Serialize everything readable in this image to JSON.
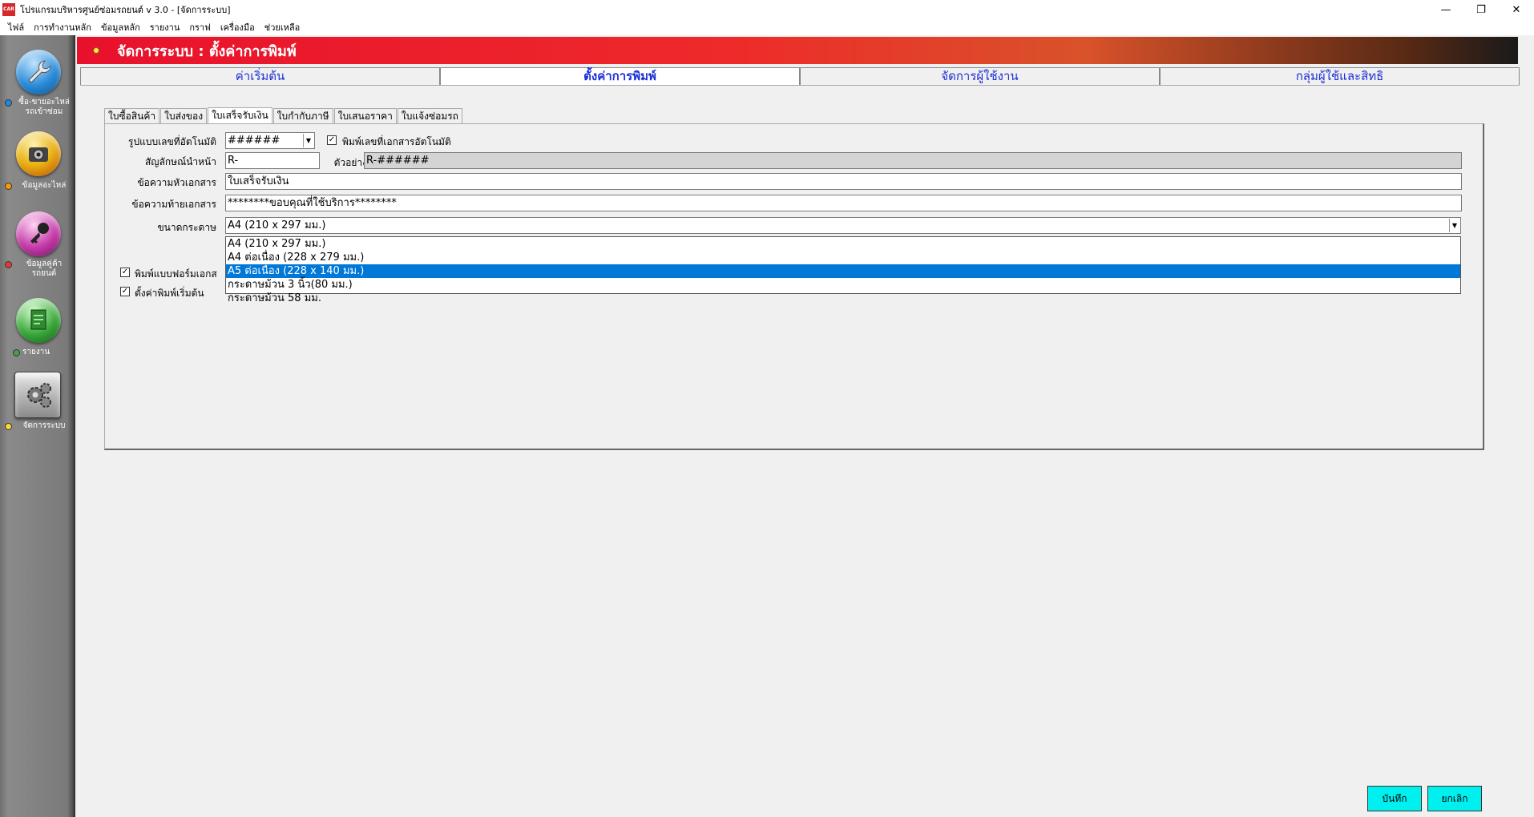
{
  "window": {
    "app_icon_text": "CAR",
    "title": "โปรแกรมบริหารศูนย์ซ่อมรถยนต์ v 3.0 - [จัดการระบบ]",
    "controls": {
      "minimize": "—",
      "restore": "❐",
      "close": "✕"
    }
  },
  "menubar": {
    "items": [
      {
        "label": "ไฟล์"
      },
      {
        "label": "การทำงานหลัก"
      },
      {
        "label": "ข้อมูลหลัก"
      },
      {
        "label": "รายงาน"
      },
      {
        "label": "กราฟ"
      },
      {
        "label": "เครื่องมือ"
      },
      {
        "label": "ช่วยเหลือ"
      }
    ]
  },
  "sidebar": {
    "items": [
      {
        "label": "ซื้อ-ขายอะไหล่ รถเข้าซ่อม",
        "icon": "wrench-icon",
        "orb_color": "#2a8bd8",
        "dot_color": "#1e88e5"
      },
      {
        "label": "ข้อมูลอะไหล่",
        "icon": "part-icon",
        "orb_color": "#e8b010",
        "dot_color": "#ff9800"
      },
      {
        "label": "ข้อมูลคู่ค้า รถยนต์",
        "icon": "key-icon",
        "orb_color": "#c43aa8",
        "dot_color": "#e53935"
      },
      {
        "label": "รายงาน",
        "icon": "report-icon",
        "orb_color": "#3aa83a",
        "dot_color": "#43a047"
      },
      {
        "label": "จัดการระบบ",
        "icon": "gear-icon",
        "orb_color": "#9a9a9a",
        "dot_color": "#fdd835"
      }
    ]
  },
  "header": {
    "title": "จัดการระบบ : ตั้งค่าการพิมพ์"
  },
  "main_tabs": [
    {
      "label": "ค่าเริ่มต้น",
      "active": false
    },
    {
      "label": "ตั้งค่าการพิมพ์",
      "active": true
    },
    {
      "label": "จัดการผู้ใช้งาน",
      "active": false
    },
    {
      "label": "กลุ่มผู้ใช้และสิทธิ",
      "active": false
    }
  ],
  "sub_tabs": [
    {
      "label": "ใบซื้อสินค้า",
      "active": false
    },
    {
      "label": "ใบส่งของ",
      "active": false
    },
    {
      "label": "ใบเสร็จรับเงิน",
      "active": true
    },
    {
      "label": "ใบกำกับภาษี",
      "active": false
    },
    {
      "label": "ใบเสนอราคา",
      "active": false
    },
    {
      "label": "ใบแจ้งซ่อมรถ",
      "active": false
    }
  ],
  "form": {
    "auto_number_format_label": "รูปแบบเลขที่อัตโนมัติ",
    "auto_number_format_value": "######",
    "print_auto_number_label": "พิมพ์เลขที่เอกสารอัตโนมัติ",
    "print_auto_number_checked": true,
    "prefix_label": "สัญลักษณ์นำหน้า",
    "prefix_value": "R-",
    "example_label": "ตัวอย่าง",
    "example_value": "R-######",
    "header_text_label": "ข้อความหัวเอกสาร",
    "header_text_value": "ใบเสร็จรับเงิน",
    "footer_text_label": "ข้อความท้ายเอกสาร",
    "footer_text_value": "********ขอบคุณที่ใช้บริการ********",
    "paper_size_label": "ขนาดกระดาษ",
    "paper_size_value": "A4 (210 x 297 มม.)",
    "paper_size_options": [
      {
        "label": "A4 (210 x 297 มม.)",
        "selected": false
      },
      {
        "label": "A4 ต่อเนื่อง (228 x 279 มม.)",
        "selected": false
      },
      {
        "label": "A5 ต่อเนื่อง (228 x 140 มม.)",
        "selected": true
      },
      {
        "label": "กระดาษม้วน 3 นิ้ว(80 มม.)",
        "selected": false
      },
      {
        "label": "กระดาษม้วน 58 มม.",
        "selected": false
      }
    ],
    "print_form_label": "พิมพ์แบบฟอร์มเอกส",
    "print_form_checked": true,
    "default_print_label": "ตั้งค่าพิมพ์เริ่มต้น",
    "default_print_checked": true
  },
  "buttons": {
    "save": "บันทึก",
    "cancel": "ยกเลิก"
  }
}
